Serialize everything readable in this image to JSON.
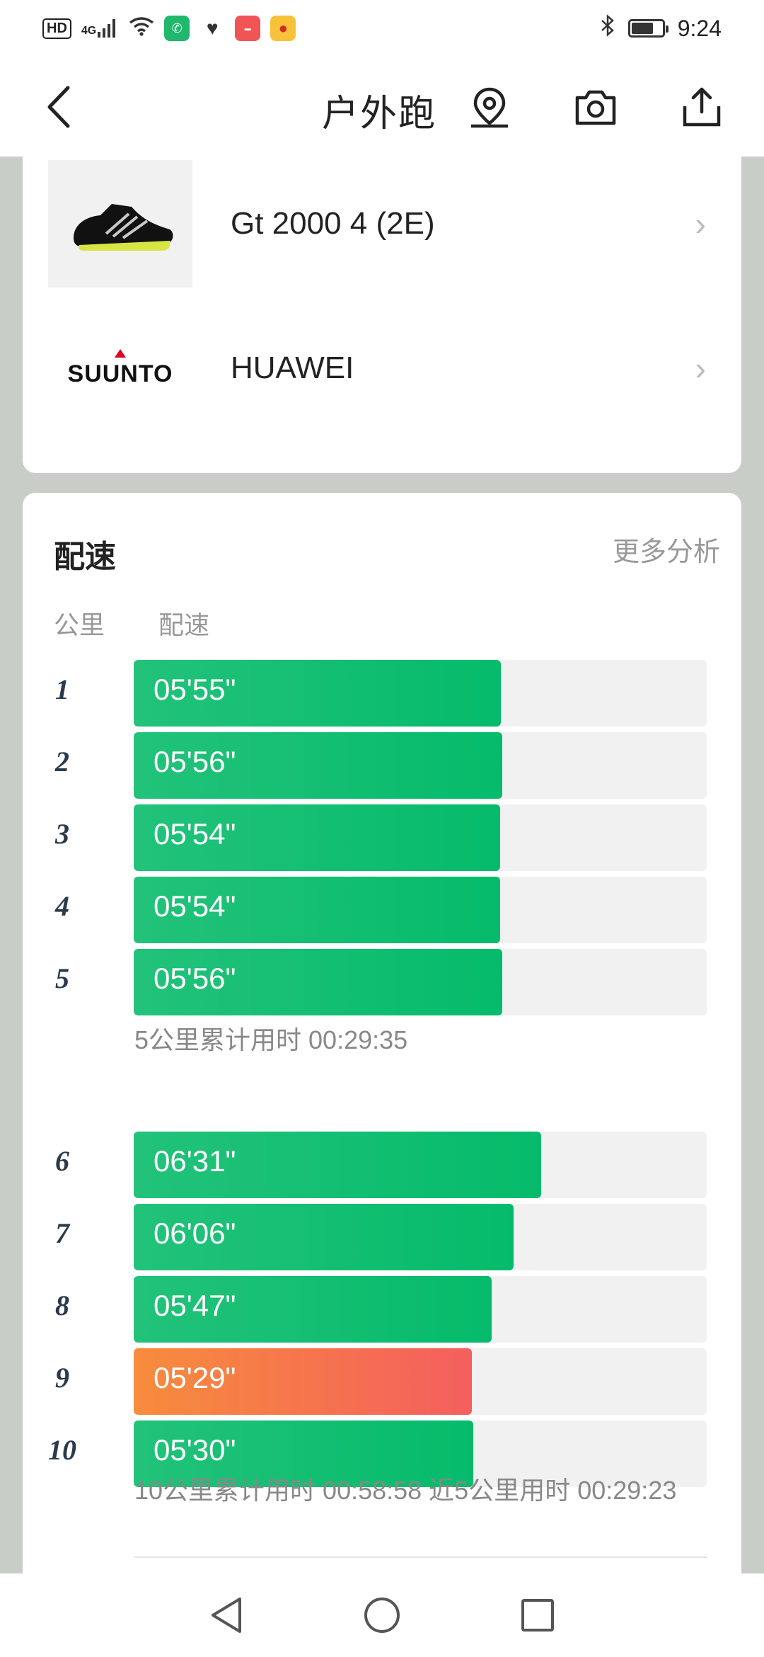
{
  "status_bar": {
    "hd": "HD",
    "network": "4G",
    "time": "9:24",
    "app_icons": [
      "messenger-icon",
      "health-icon",
      "huawei-app-icon",
      "weibo-icon"
    ]
  },
  "title_bar": {
    "title": "户外跑"
  },
  "gear": [
    {
      "name": "Gt 2000 4 (2E)",
      "icon": "running-shoe-image"
    },
    {
      "name": "HUAWEI",
      "brand_text": "SUUNTO",
      "icon": "suunto-logo"
    }
  ],
  "pace_section": {
    "title": "配速",
    "more_link": "更多分析",
    "col_km": "公里",
    "col_pace": "配速",
    "rows_group1": [
      {
        "km": "1",
        "pace": "05'55\"",
        "fill": 0.641
      },
      {
        "km": "2",
        "pace": "05'56\"",
        "fill": 0.643
      },
      {
        "km": "3",
        "pace": "05'54\"",
        "fill": 0.639
      },
      {
        "km": "4",
        "pace": "05'54\"",
        "fill": 0.639
      },
      {
        "km": "5",
        "pace": "05'56\"",
        "fill": 0.643
      }
    ],
    "summary1": "5公里累计用时 00:29:35",
    "rows_group2": [
      {
        "km": "6",
        "pace": "06'31\"",
        "fill": 0.711
      },
      {
        "km": "7",
        "pace": "06'06\"",
        "fill": 0.663
      },
      {
        "km": "8",
        "pace": "05'47\"",
        "fill": 0.625
      },
      {
        "km": "9",
        "pace": "05'29\"",
        "fill": 0.59,
        "highlight": "fastest"
      },
      {
        "km": "10",
        "pace": "05'30\"",
        "fill": 0.592
      }
    ],
    "summary2": "10公里累计用时 00:58:58   近5公里用时 00:29:23"
  },
  "colors": {
    "bar_green": "#05bb6b",
    "bar_orange": "#f78c3c",
    "bar_red": "#f45f5e",
    "track": "#f1f1f1"
  }
}
